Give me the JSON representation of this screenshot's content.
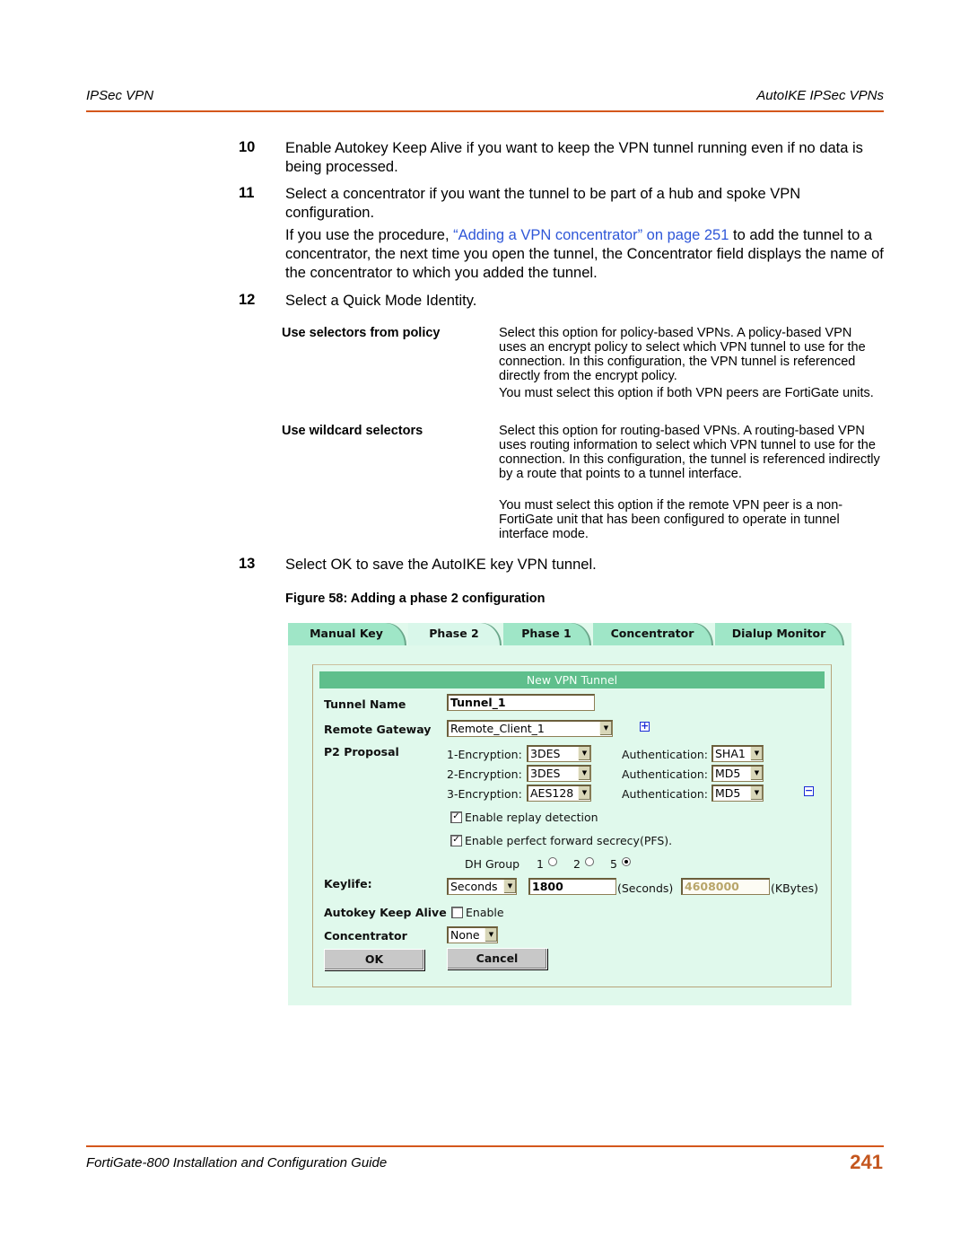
{
  "header": {
    "left": "IPSec VPN",
    "right": "AutoIKE IPSec VPNs"
  },
  "footer": {
    "title": "FortiGate-800 Installation and Configuration Guide",
    "page_number": "241"
  },
  "colors": {
    "rule": "#d4571c",
    "link": "#2f57d8",
    "page_number": "#c4561e",
    "panel_bg": "#e0f9ec",
    "tab_bg": "#9fe6c7",
    "title_bar": "#5fbf8c"
  },
  "steps": [
    {
      "num": "10",
      "text": "Enable Autokey Keep Alive if you want to keep the VPN tunnel running even if no data is being processed."
    },
    {
      "num": "11",
      "text": "Select a concentrator if you want the tunnel to be part of a hub and spoke VPN configuration."
    },
    {
      "num": "12",
      "text": "Select a Quick Mode Identity."
    },
    {
      "num": "13",
      "text": "Select OK to save the AutoIKE key VPN tunnel."
    }
  ],
  "step11_note": {
    "before": "If you use the procedure, ",
    "link": "“Adding a VPN concentrator” on page 251",
    "after": " to add the tunnel to a concentrator, the next time you open the tunnel, the Concentrator field displays the name of the concentrator to which you added the tunnel."
  },
  "definitions": [
    {
      "term": "Use selectors from policy",
      "desc1": "Select this option for policy-based VPNs. A policy-based VPN uses an encrypt policy to select which VPN tunnel to use for the connection. In this configuration, the VPN tunnel is referenced directly from the encrypt policy.",
      "desc2": "You must select this option if both VPN peers are FortiGate units."
    },
    {
      "term": "Use wildcard selectors",
      "desc1": "Select this option for routing-based VPNs. A routing-based VPN uses routing information to select which VPN tunnel to use for the connection. In this configuration, the tunnel is referenced indirectly by a route that points to a tunnel interface.",
      "desc2": "You must select this option if the remote VPN peer is a non-FortiGate unit that has been configured to operate in tunnel interface mode."
    }
  ],
  "figure_caption": "Figure 58: Adding a phase 2 configuration",
  "ui": {
    "tabs": [
      {
        "label": "Manual Key",
        "active": false
      },
      {
        "label": "Phase 2",
        "active": true
      },
      {
        "label": "Phase 1",
        "active": false
      },
      {
        "label": "Concentrator",
        "active": false
      },
      {
        "label": "Dialup Monitor",
        "active": false
      }
    ],
    "panel_title": "New VPN Tunnel",
    "labels": {
      "tunnel_name": "Tunnel Name",
      "remote_gateway": "Remote Gateway",
      "p2_proposal": "P2 Proposal",
      "keylife": "Keylife:",
      "autokey_keep_alive": "Autokey Keep Alive",
      "concentrator": "Concentrator"
    },
    "tunnel_name_value": "Tunnel_1",
    "remote_gateway_value": "Remote_Client_1",
    "proposals": [
      {
        "enc_label": "1-Encryption:",
        "enc": "3DES",
        "auth_label": "Authentication:",
        "auth": "SHA1"
      },
      {
        "enc_label": "2-Encryption:",
        "enc": "3DES",
        "auth_label": "Authentication:",
        "auth": "MD5"
      },
      {
        "enc_label": "3-Encryption:",
        "enc": "AES128",
        "auth_label": "Authentication:",
        "auth": "MD5"
      }
    ],
    "replay_detection": {
      "label": "Enable replay detection",
      "checked": true,
      "mark": "✓"
    },
    "pfs": {
      "label": "Enable perfect forward secrecy(PFS).",
      "checked": true,
      "mark": "✓"
    },
    "dh_group": {
      "label": "DH Group",
      "options": [
        "1",
        "2",
        "5"
      ],
      "selected": "5"
    },
    "keylife_unit": "Seconds",
    "keylife_seconds": "1800",
    "seconds_label": "(Seconds)",
    "keylife_kbytes": "4608000",
    "kbytes_label": "(KBytes)",
    "keep_alive": {
      "label": "Enable",
      "checked": false
    },
    "concentrator_value": "None",
    "ok_label": "OK",
    "cancel_label": "Cancel",
    "icons": {
      "add": "plus-square-icon",
      "remove": "minus-square-icon",
      "dropdown": "chevron-down-icon"
    },
    "glyphs": {
      "plus": "+",
      "minus": "−",
      "arrow": "▼"
    }
  }
}
